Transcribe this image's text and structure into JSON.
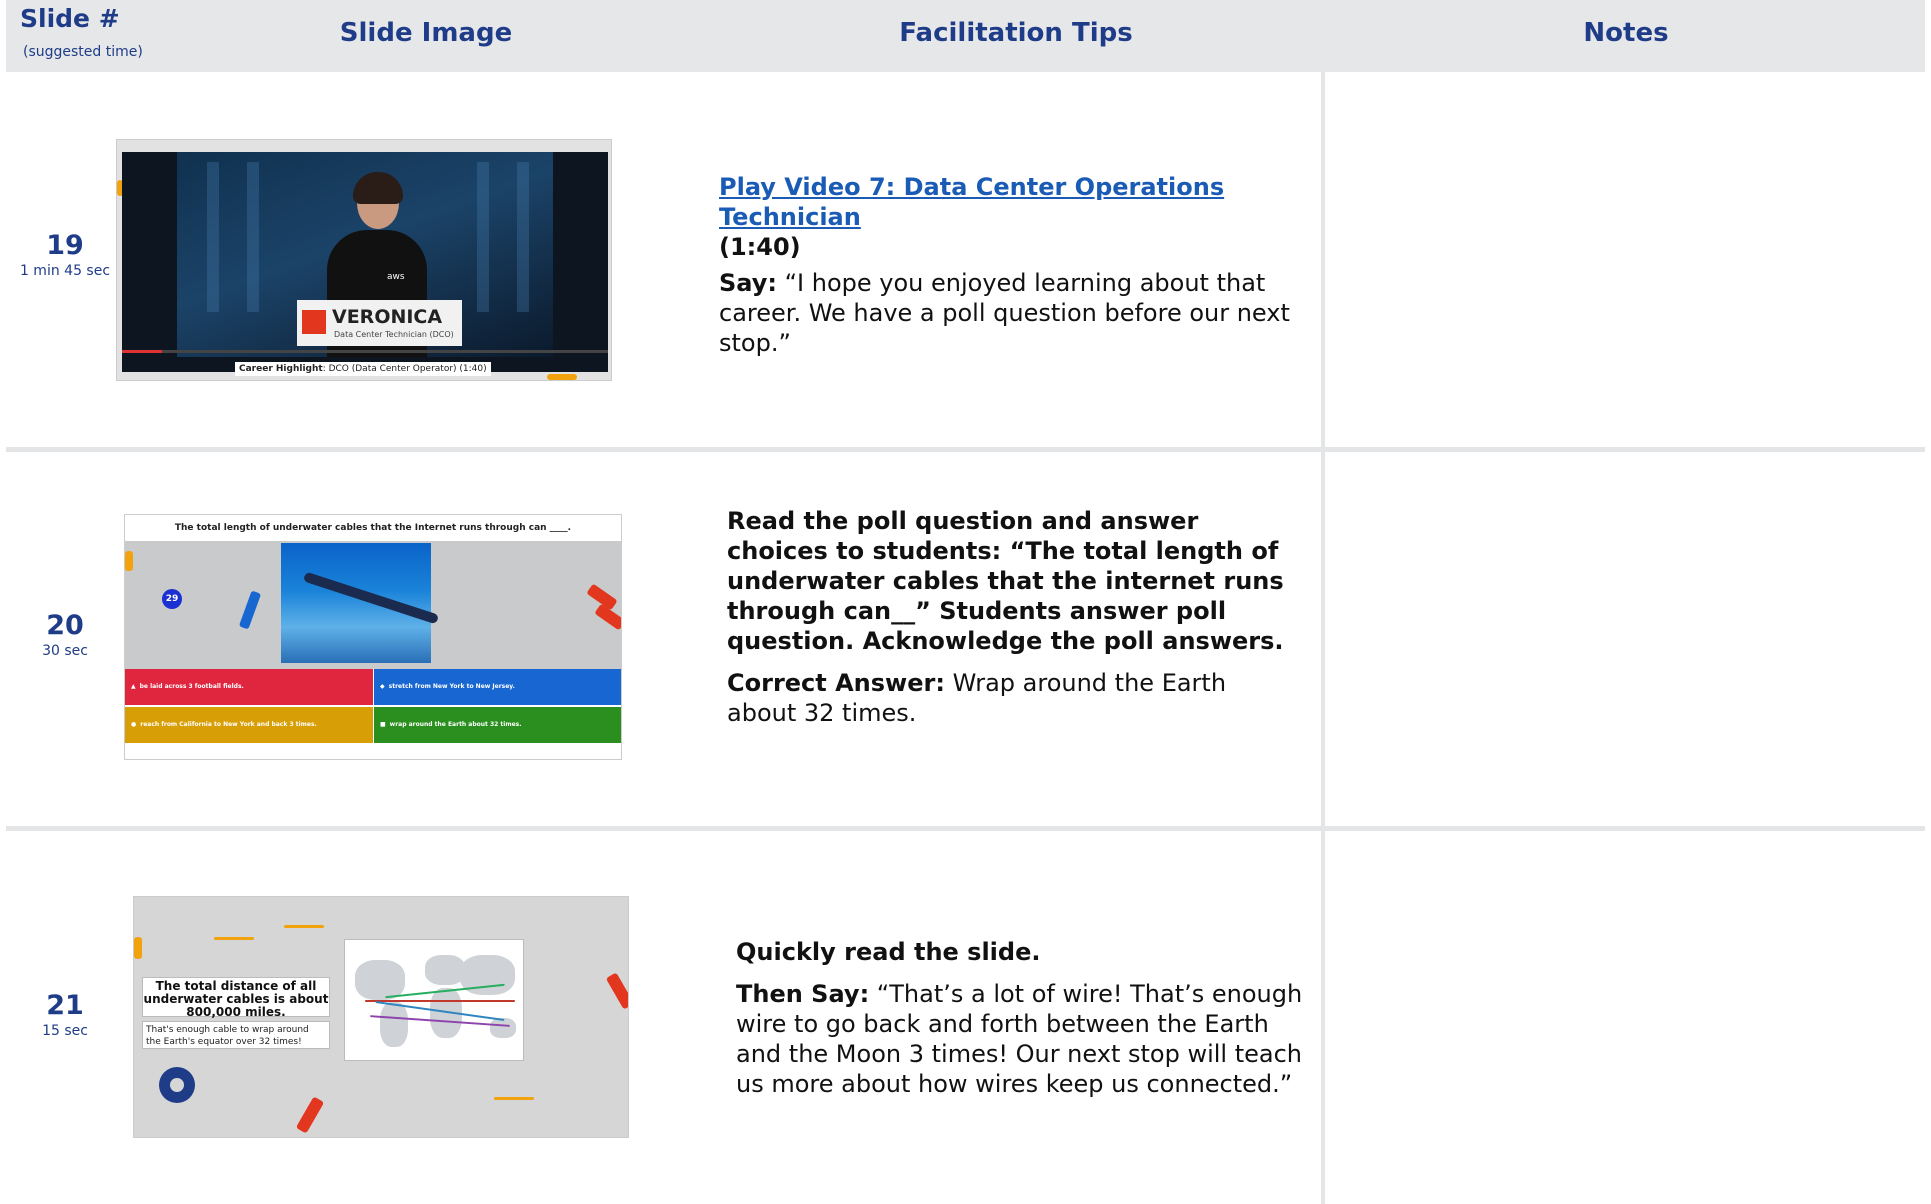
{
  "header": {
    "slide_col": "Slide #",
    "slide_col_sub": "(suggested time)",
    "image_col": "Slide Image",
    "tips_col": "Facilitation Tips",
    "notes_col": "Notes"
  },
  "rows": [
    {
      "number": "19",
      "time": "1 min 45 sec",
      "video_link": "Play Video 7: Data Center Operations Technician",
      "duration": "(1:40)",
      "say_label": "Say:",
      "say_text": " “I hope you enjoyed learning about that career. We have a poll question before our next stop.”",
      "thumb": {
        "lower_third_name": "VERONICA",
        "lower_third_role": "Data Center Technician (DCO)",
        "caption_bold": "Career Highlight",
        "caption_rest": ": DCO (Data Center Operator) (1:40)",
        "logo": "aws"
      }
    },
    {
      "number": "20",
      "time": "30 sec",
      "instruction": "Read the poll question and answer choices to students: “The total length of underwater cables that the internet runs through can__” Students answer poll question. Acknowledge the poll answers.",
      "answer_label": "Correct Answer:",
      "answer_text": " Wrap around the Earth about 32 times.",
      "thumb": {
        "question": "The total length of underwater cables that the Internet runs through can ____.",
        "badge": "29",
        "options": [
          {
            "text": "be laid across 3 football fields.",
            "color": "#e0253f",
            "marker": "▲"
          },
          {
            "text": "stretch from New York to New Jersey.",
            "color": "#1866d1",
            "marker": "◆"
          },
          {
            "text": "reach from California to New York and back 3 times.",
            "color": "#d89e06",
            "marker": "●"
          },
          {
            "text": "wrap around the Earth about 32 times.",
            "color": "#2a8f1e",
            "marker": "■"
          }
        ]
      }
    },
    {
      "number": "21",
      "time": "15 sec",
      "line1": "Quickly read the slide.",
      "then_label": "Then Say:",
      "then_text": " “That’s a lot of wire! That’s enough wire to go back and forth between the Earth and the Moon 3 times! Our next stop will teach us more about how wires keep us connected.”",
      "thumb": {
        "fact": "The total distance of all underwater cables is about 800,000 miles.",
        "fact_sub": "That's enough cable to wrap around the Earth's equator over 32 times!"
      }
    }
  ],
  "colors": {
    "header_bg": "#e6e7e9",
    "header_text": "#1f3c88",
    "link": "#1a5bb5",
    "divider": "#e4e5e7"
  }
}
